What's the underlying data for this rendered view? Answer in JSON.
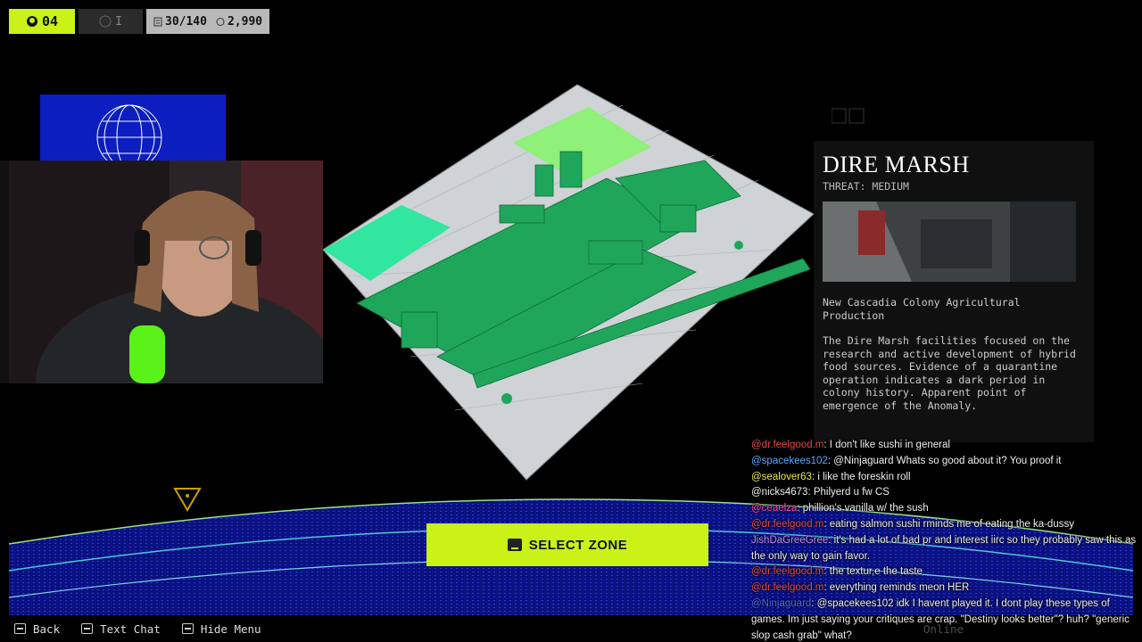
{
  "hud": {
    "level": "04",
    "rank": "I",
    "inventory": "30/140",
    "credits": "2,990"
  },
  "zone": {
    "title": "DIRE MARSH",
    "threat": "THREAT: MEDIUM",
    "subtitle": "New Cascadia Colony Agricultural Production",
    "description": "The Dire Marsh facilities focused on the research and active development of hybrid food sources. Evidence of a quarantine operation indicates a dark period in colony history. Apparent point of emergence of the Anomaly."
  },
  "select_zone": "SELECT ZONE",
  "chat": [
    {
      "user": "@dr.feelgood.m",
      "text": ": I don't like sushi in general",
      "color": "#e04a4a"
    },
    {
      "user": "@spacekees102",
      "text": ": @Ninjaguard Whats so good about it? You proof it",
      "color": "#5aa9ff"
    },
    {
      "user": "@sealover63",
      "text": ": i like the foreskin roll",
      "color": "#e8e84a"
    },
    {
      "user": "@nicks4673",
      "text": ": Philyerd u fw CS",
      "color": "#f0f0f0"
    },
    {
      "user": "@ceaelza",
      "text": ": phillion's vanilla w/ the sush",
      "color": "#ff4aa8"
    },
    {
      "user": "@dr.feelgood.m",
      "text": ": eating salmon sushi rminds me of eating the ka-dussy",
      "color": "#e04a4a"
    },
    {
      "user": "JishDaGreeGree",
      "text": ": it's had a lot of bad pr and interest iirc so they probably saw this as the only way to gain favor.",
      "color": "#c98bff"
    },
    {
      "user": "@dr.feelgood.m",
      "text": ": the textur,e the taste",
      "color": "#e04a4a"
    },
    {
      "user": "@dr.feelgood.m",
      "text": ": everything reminds meon HER",
      "color": "#e04a4a"
    },
    {
      "user": "@Ninjaguard",
      "text": ": @spacekees102 idk I havent played it. I dont play these types of games. Im just saying your critiques are crap. \"Destiny looks better\"? huh? \"generic slop cash grab\" what?",
      "color": "#4a6aff"
    }
  ],
  "bottom": {
    "back": "Back",
    "text_chat": "Text Chat",
    "hide_menu": "Hide Menu",
    "online": "Online"
  },
  "colors": {
    "accent": "#c8f218",
    "map_green": "#1fa65a",
    "panel_bg": "#101010"
  }
}
